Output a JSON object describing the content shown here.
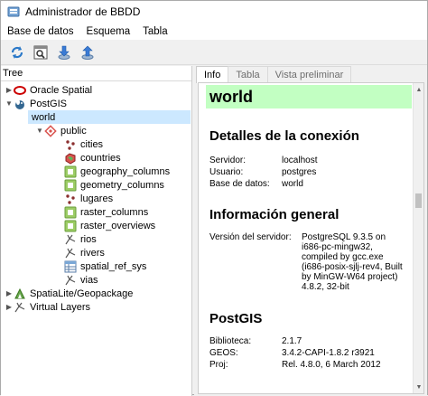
{
  "window": {
    "title": "Administrador de BBDD"
  },
  "menu": [
    "Base de datos",
    "Esquema",
    "Tabla"
  ],
  "toolbar": [
    {
      "name": "refresh-icon"
    },
    {
      "name": "sql-window-icon"
    },
    {
      "name": "import-layer-icon"
    },
    {
      "name": "export-icon"
    }
  ],
  "tree": {
    "header": "Tree",
    "rows": [
      {
        "label": "Oracle Spatial",
        "level": 0,
        "arrow": "right",
        "icon": "oracle-icon",
        "selected": false
      },
      {
        "label": "PostGIS",
        "level": 0,
        "arrow": "down",
        "icon": "postgis-icon",
        "selected": false
      },
      {
        "label": "world",
        "level": 1,
        "arrow": "",
        "icon": "",
        "selected": true
      },
      {
        "label": "public",
        "level": 2,
        "arrow": "down",
        "icon": "schema-icon",
        "selected": false
      },
      {
        "label": "cities",
        "level": 3,
        "arrow": "",
        "icon": "point-layer-icon",
        "selected": false
      },
      {
        "label": "countries",
        "level": 3,
        "arrow": "",
        "icon": "polygon-layer-icon",
        "selected": false
      },
      {
        "label": "geography_columns",
        "level": 3,
        "arrow": "",
        "icon": "table-icon",
        "selected": false
      },
      {
        "label": "geometry_columns",
        "level": 3,
        "arrow": "",
        "icon": "table-icon",
        "selected": false
      },
      {
        "label": "lugares",
        "level": 3,
        "arrow": "",
        "icon": "point-layer-icon",
        "selected": false
      },
      {
        "label": "raster_columns",
        "level": 3,
        "arrow": "",
        "icon": "table-icon",
        "selected": false
      },
      {
        "label": "raster_overviews",
        "level": 3,
        "arrow": "",
        "icon": "table-icon",
        "selected": false
      },
      {
        "label": "rios",
        "level": 3,
        "arrow": "",
        "icon": "line-layer-icon",
        "selected": false
      },
      {
        "label": "rivers",
        "level": 3,
        "arrow": "",
        "icon": "line-layer-icon",
        "selected": false
      },
      {
        "label": "spatial_ref_sys",
        "level": 3,
        "arrow": "",
        "icon": "grid-table-icon",
        "selected": false
      },
      {
        "label": "vias",
        "level": 3,
        "arrow": "",
        "icon": "line-layer-icon",
        "selected": false
      },
      {
        "label": "SpatiaLite/Geopackage",
        "level": 0,
        "arrow": "right",
        "icon": "spatialite-icon",
        "selected": false
      },
      {
        "label": "Virtual Layers",
        "level": 0,
        "arrow": "right",
        "icon": "virtual-layers-icon",
        "selected": false
      }
    ]
  },
  "tabs": [
    {
      "label": "Info",
      "active": true
    },
    {
      "label": "Tabla",
      "active": false
    },
    {
      "label": "Vista preliminar",
      "active": false
    }
  ],
  "info": {
    "db_name": "world",
    "connection": {
      "heading": "Detalles de la conexión",
      "fields": [
        {
          "key": "Servidor:",
          "value": "localhost"
        },
        {
          "key": "Usuario:",
          "value": "postgres"
        },
        {
          "key": "Base de datos:",
          "value": "world"
        }
      ]
    },
    "server": {
      "heading": "Información general",
      "key": "Versión del servidor:",
      "value_lines": [
        "PostgreSQL 9.3.5 on",
        "i686-pc-mingw32,",
        "compiled by gcc.exe",
        "(i686-posix-sjlj-rev4, Built",
        "by MinGW-W64 project)",
        "4.8.2, 32-bit"
      ]
    },
    "postgis": {
      "heading": "PostGIS",
      "fields": [
        {
          "key": "Biblioteca:",
          "value": "2.1.7"
        },
        {
          "key": "GEOS:",
          "value": "3.4.2-CAPI-1.8.2 r3921"
        },
        {
          "key": "Proj:",
          "value": "Rel. 4.8.0, 6 March 2012"
        }
      ]
    }
  },
  "colors": {
    "selection": "#cce8ff",
    "banner": "#c2ffc2"
  }
}
